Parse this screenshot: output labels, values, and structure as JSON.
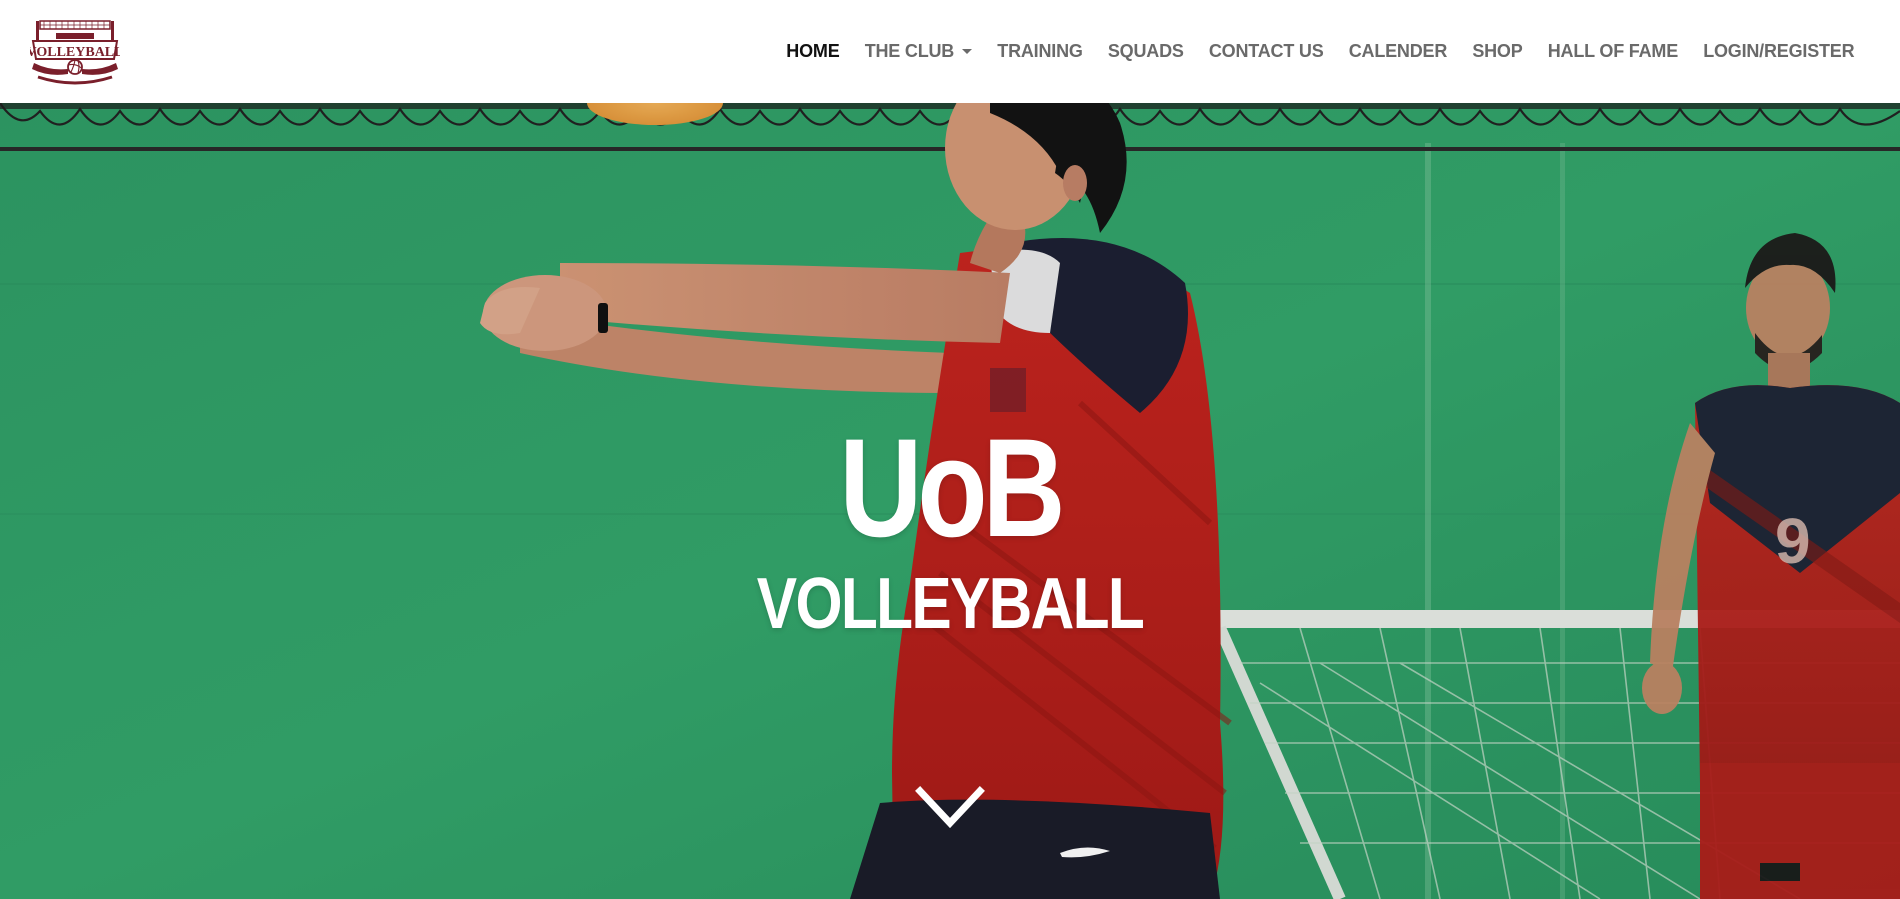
{
  "brand": {
    "logo_text": "VOLLEYBALL",
    "logo_icon": "volleyball-club-crest"
  },
  "nav": {
    "items": [
      {
        "label": "HOME",
        "active": true
      },
      {
        "label": "THE CLUB",
        "dropdown": true
      },
      {
        "label": "TRAINING"
      },
      {
        "label": "SQUADS"
      },
      {
        "label": "CONTACT US"
      },
      {
        "label": "CALENDER"
      },
      {
        "label": "SHOP"
      },
      {
        "label": "HALL OF FAME"
      },
      {
        "label": "LOGIN/REGISTER"
      }
    ]
  },
  "hero": {
    "title": "UoB",
    "subtitle": "VOLLEYBALL",
    "scroll_icon": "chevron-down-icon"
  },
  "colors": {
    "brand_maroon": "#7a1f2b",
    "court_green": "#2e9e68",
    "jersey_red": "#c0201c",
    "jersey_navy": "#1c1f33",
    "nav_text": "#6a6a6a",
    "nav_active": "#111111"
  }
}
